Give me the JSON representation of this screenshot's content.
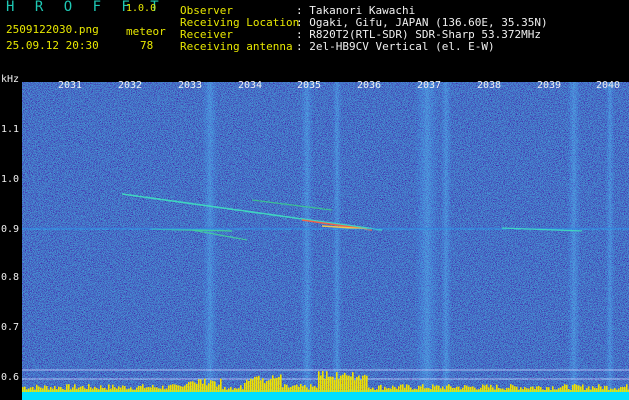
{
  "header": {
    "app_name": "H R O F F T",
    "version": "1.0.0",
    "filename": "2509122030.png",
    "datetime": "25.09.12 20:30",
    "count_label": "meteor",
    "count_value": "78",
    "fields": [
      {
        "label": "Observer",
        "value": ": Takanori Kawachi"
      },
      {
        "label": "Receiving Location",
        "value": ": Ogaki, Gifu, JAPAN (136.60E, 35.35N)"
      },
      {
        "label": "Receiver",
        "value": ": R820T2(RTL-SDR) SDR-Sharp 53.372MHz"
      },
      {
        "label": "Receiving antenna",
        "value": ": 2el-HB9CV Vertical (el. E-W)"
      }
    ]
  },
  "plot": {
    "y_unit": "kHz",
    "y_ticks": [
      "1.1",
      "1.0",
      "0.9",
      "0.8",
      "0.7",
      "0.6"
    ],
    "x_ticks": [
      "2031",
      "2032",
      "2033",
      "2034",
      "2035",
      "2036",
      "2037",
      "2038",
      "2039",
      "2040"
    ]
  },
  "colors": {
    "background": "#000000",
    "spectrogram_base": "#0b1f7a",
    "label_yellow": "#e8e800",
    "label_white": "#f0f0f0",
    "logo": "#1ec8b4",
    "signal_level": "#f0e000",
    "noise_floor": "#00e0ff"
  }
}
